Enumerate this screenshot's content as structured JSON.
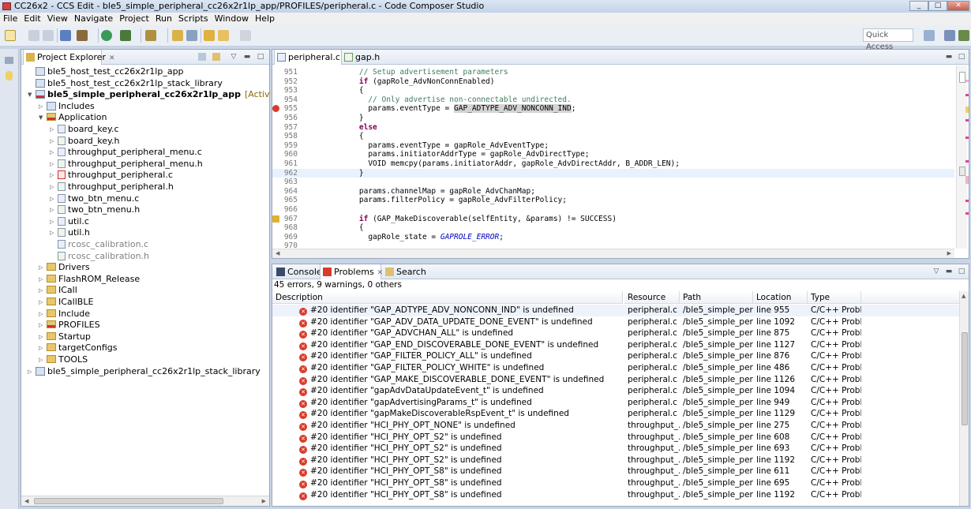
{
  "window": {
    "title": "CC26x2 - CCS Edit - ble5_simple_peripheral_cc26x2r1lp_app/PROFILES/peripheral.c - Code Composer Studio",
    "minimize": "_",
    "maximize": "□",
    "close": "✕"
  },
  "menu": [
    "File",
    "Edit",
    "View",
    "Navigate",
    "Project",
    "Run",
    "Scripts",
    "Window",
    "Help"
  ],
  "toolbar": {
    "quick_access": "Quick Access"
  },
  "project_explorer": {
    "tab_label": "Project Explorer",
    "items": [
      {
        "label": "ble5_host_test_cc26x2r1lp_app",
        "level": 0,
        "kind": "project",
        "twisty": "",
        "bold": false
      },
      {
        "label": "ble5_host_test_cc26x2r1lp_stack_library",
        "level": 0,
        "kind": "project",
        "twisty": "",
        "bold": false
      },
      {
        "label": "ble5_simple_peripheral_cc26x2r1lp_app",
        "level": 0,
        "kind": "project-err",
        "twisty": "▼",
        "bold": true,
        "note": "[Active - FlashROM_R"
      },
      {
        "label": "Includes",
        "level": 1,
        "kind": "includes",
        "twisty": "▷"
      },
      {
        "label": "Application",
        "level": 1,
        "kind": "folder-err",
        "twisty": "▼"
      },
      {
        "label": "board_key.c",
        "level": 2,
        "kind": "c",
        "twisty": "▷"
      },
      {
        "label": "board_key.h",
        "level": 2,
        "kind": "h",
        "twisty": "▷"
      },
      {
        "label": "throughput_peripheral_menu.c",
        "level": 2,
        "kind": "c",
        "twisty": "▷"
      },
      {
        "label": "throughput_peripheral_menu.h",
        "level": 2,
        "kind": "h",
        "twisty": "▷"
      },
      {
        "label": "throughput_peripheral.c",
        "level": 2,
        "kind": "c-err",
        "twisty": "▷"
      },
      {
        "label": "throughput_peripheral.h",
        "level": 2,
        "kind": "h",
        "twisty": "▷"
      },
      {
        "label": "two_btn_menu.c",
        "level": 2,
        "kind": "c",
        "twisty": "▷"
      },
      {
        "label": "two_btn_menu.h",
        "level": 2,
        "kind": "h",
        "twisty": "▷"
      },
      {
        "label": "util.c",
        "level": 2,
        "kind": "c",
        "twisty": "▷"
      },
      {
        "label": "util.h",
        "level": 2,
        "kind": "h",
        "twisty": "▷"
      },
      {
        "label": "rcosc_calibration.c",
        "level": 2,
        "kind": "c-gray",
        "twisty": ""
      },
      {
        "label": "rcosc_calibration.h",
        "level": 2,
        "kind": "h-gray",
        "twisty": ""
      },
      {
        "label": "Drivers",
        "level": 1,
        "kind": "folder",
        "twisty": "▷"
      },
      {
        "label": "FlashROM_Release",
        "level": 1,
        "kind": "folder",
        "twisty": "▷"
      },
      {
        "label": "ICall",
        "level": 1,
        "kind": "folder",
        "twisty": "▷"
      },
      {
        "label": "ICallBLE",
        "level": 1,
        "kind": "folder",
        "twisty": "▷"
      },
      {
        "label": "Include",
        "level": 1,
        "kind": "folder",
        "twisty": "▷"
      },
      {
        "label": "PROFILES",
        "level": 1,
        "kind": "folder-err",
        "twisty": "▷"
      },
      {
        "label": "Startup",
        "level": 1,
        "kind": "folder",
        "twisty": "▷"
      },
      {
        "label": "targetConfigs",
        "level": 1,
        "kind": "folder",
        "twisty": "▷"
      },
      {
        "label": "TOOLS",
        "level": 1,
        "kind": "folder",
        "twisty": "▷"
      },
      {
        "label": "ble5_simple_peripheral_cc26x2r1lp_stack_library",
        "level": 0,
        "kind": "project",
        "twisty": "▷"
      }
    ]
  },
  "editor": {
    "tabs": [
      {
        "label": "peripheral.c",
        "active": true
      },
      {
        "label": "gap.h",
        "active": false
      }
    ],
    "lines": [
      {
        "n": "951",
        "code": "    // Setup advertisement parameters",
        "type": "cmt"
      },
      {
        "n": "952",
        "code": "    if (gapRole_AdvNonConnEnabled)",
        "type": "kwif"
      },
      {
        "n": "953",
        "code": "    {",
        "type": "plain"
      },
      {
        "n": "954",
        "code": "      // Only advertise non-connectable undirected.",
        "type": "cmt"
      },
      {
        "n": "955",
        "code": "      params.eventType = GAP_ADTYPE_ADV_NONCONN_IND;",
        "type": "sel",
        "marker": "error"
      },
      {
        "n": "956",
        "code": "    }",
        "type": "plain"
      },
      {
        "n": "957",
        "code": "    else",
        "type": "kwelse"
      },
      {
        "n": "958",
        "code": "    {",
        "type": "plain"
      },
      {
        "n": "959",
        "code": "      params.eventType = gapRole_AdvEventType;",
        "type": "plain"
      },
      {
        "n": "960",
        "code": "      params.initiatorAddrType = gapRole_AdvDirectType;",
        "type": "plain"
      },
      {
        "n": "961",
        "code": "      VOID memcpy(params.initiatorAddr, gapRole_AdvDirectAddr, B_ADDR_LEN);",
        "type": "plain"
      },
      {
        "n": "962",
        "code": "    }",
        "type": "cur"
      },
      {
        "n": "963",
        "code": "",
        "type": "plain"
      },
      {
        "n": "964",
        "code": "    params.channelMap = gapRole_AdvChanMap;",
        "type": "plain"
      },
      {
        "n": "965",
        "code": "    params.filterPolicy = gapRole_AdvFilterPolicy;",
        "type": "plain"
      },
      {
        "n": "966",
        "code": "",
        "type": "plain"
      },
      {
        "n": "967",
        "code": "    if (GAP_MakeDiscoverable(selfEntity, &params) != SUCCESS)",
        "type": "kwif",
        "marker": "warning"
      },
      {
        "n": "968",
        "code": "    {",
        "type": "plain"
      },
      {
        "n": "969",
        "code": "      gapRole_state = GAPROLE_ERROR;",
        "type": "state"
      },
      {
        "n": "970",
        "code": "",
        "type": "plain"
      }
    ]
  },
  "bottom": {
    "tabs": [
      "Console",
      "Problems",
      "Search"
    ],
    "summary": "45 errors, 9 warnings, 0 others",
    "columns": [
      "Description",
      "Resource",
      "Path",
      "Location",
      "Type"
    ],
    "rows": [
      {
        "desc": "#20 identifier \"GAP_ADTYPE_ADV_NONCONN_IND\" is undefined",
        "res": "peripheral.c",
        "path": "/ble5_simple_peri...",
        "loc": "line 955",
        "type": "C/C++ Probl..."
      },
      {
        "desc": "#20 identifier \"GAP_ADV_DATA_UPDATE_DONE_EVENT\" is undefined",
        "res": "peripheral.c",
        "path": "/ble5_simple_peri...",
        "loc": "line 1092",
        "type": "C/C++ Probl..."
      },
      {
        "desc": "#20 identifier \"GAP_ADVCHAN_ALL\" is undefined",
        "res": "peripheral.c",
        "path": "/ble5_simple_peri...",
        "loc": "line 875",
        "type": "C/C++ Probl..."
      },
      {
        "desc": "#20 identifier \"GAP_END_DISCOVERABLE_DONE_EVENT\" is undefined",
        "res": "peripheral.c",
        "path": "/ble5_simple_peri...",
        "loc": "line 1127",
        "type": "C/C++ Probl..."
      },
      {
        "desc": "#20 identifier \"GAP_FILTER_POLICY_ALL\" is undefined",
        "res": "peripheral.c",
        "path": "/ble5_simple_peri...",
        "loc": "line 876",
        "type": "C/C++ Probl..."
      },
      {
        "desc": "#20 identifier \"GAP_FILTER_POLICY_WHITE\" is undefined",
        "res": "peripheral.c",
        "path": "/ble5_simple_peri...",
        "loc": "line 486",
        "type": "C/C++ Probl..."
      },
      {
        "desc": "#20 identifier \"GAP_MAKE_DISCOVERABLE_DONE_EVENT\" is undefined",
        "res": "peripheral.c",
        "path": "/ble5_simple_peri...",
        "loc": "line 1126",
        "type": "C/C++ Probl..."
      },
      {
        "desc": "#20 identifier \"gapAdvDataUpdateEvent_t\" is undefined",
        "res": "peripheral.c",
        "path": "/ble5_simple_peri...",
        "loc": "line 1094",
        "type": "C/C++ Probl..."
      },
      {
        "desc": "#20 identifier \"gapAdvertisingParams_t\" is undefined",
        "res": "peripheral.c",
        "path": "/ble5_simple_peri...",
        "loc": "line 949",
        "type": "C/C++ Probl..."
      },
      {
        "desc": "#20 identifier \"gapMakeDiscoverableRspEvent_t\" is undefined",
        "res": "peripheral.c",
        "path": "/ble5_simple_peri...",
        "loc": "line 1129",
        "type": "C/C++ Probl..."
      },
      {
        "desc": "#20 identifier \"HCI_PHY_OPT_NONE\" is undefined",
        "res": "throughput_...",
        "path": "/ble5_simple_peri...",
        "loc": "line 275",
        "type": "C/C++ Probl..."
      },
      {
        "desc": "#20 identifier \"HCI_PHY_OPT_S2\" is undefined",
        "res": "throughput_...",
        "path": "/ble5_simple_peri...",
        "loc": "line 608",
        "type": "C/C++ Probl..."
      },
      {
        "desc": "#20 identifier \"HCI_PHY_OPT_S2\" is undefined",
        "res": "throughput_...",
        "path": "/ble5_simple_peri...",
        "loc": "line 693",
        "type": "C/C++ Probl..."
      },
      {
        "desc": "#20 identifier \"HCI_PHY_OPT_S2\" is undefined",
        "res": "throughput_...",
        "path": "/ble5_simple_peri...",
        "loc": "line 1192",
        "type": "C/C++ Probl..."
      },
      {
        "desc": "#20 identifier \"HCI_PHY_OPT_S8\" is undefined",
        "res": "throughput_...",
        "path": "/ble5_simple_peri...",
        "loc": "line 611",
        "type": "C/C++ Probl..."
      },
      {
        "desc": "#20 identifier \"HCI_PHY_OPT_S8\" is undefined",
        "res": "throughput_...",
        "path": "/ble5_simple_peri...",
        "loc": "line 695",
        "type": "C/C++ Probl..."
      },
      {
        "desc": "#20 identifier \"HCI_PHY_OPT_S8\" is undefined",
        "res": "throughput_...",
        "path": "/ble5_simple_peri...",
        "loc": "line 1192",
        "type": "C/C++ Probl..."
      }
    ]
  },
  "colors": {
    "error": "#d93b2b",
    "warning": "#e0b030",
    "accent": "#3875d7"
  }
}
